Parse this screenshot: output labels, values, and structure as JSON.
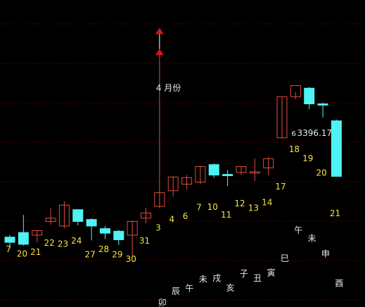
{
  "colors": {
    "background": "#000000",
    "up": "#e24b3a",
    "down": "#4ff3f3",
    "grid": "#5a0000",
    "count_label": "#f5e33a",
    "branch_label": "#e8e8e8",
    "marker": "#e01010",
    "vline": "#ffffff"
  },
  "annotations": {
    "month_label": "4 月份",
    "price_label": "3396.17",
    "price_marker": "6"
  },
  "chart_data": {
    "type": "candlestick",
    "ylim": [
      2970,
      3440
    ],
    "grid": true,
    "candles": [
      {
        "o": 3077,
        "h": 3080,
        "l": 3060,
        "c": 3069
      },
      {
        "o": 3084,
        "h": 3111,
        "l": 3064,
        "c": 3066
      },
      {
        "o": 3080,
        "h": 3087,
        "l": 3069,
        "c": 3087
      },
      {
        "o": 3101,
        "h": 3121,
        "l": 3096,
        "c": 3106
      },
      {
        "o": 3094,
        "h": 3132,
        "l": 3090,
        "c": 3126
      },
      {
        "o": 3119,
        "h": 3120,
        "l": 3095,
        "c": 3101
      },
      {
        "o": 3104,
        "h": 3106,
        "l": 3072,
        "c": 3094
      },
      {
        "o": 3090,
        "h": 3094,
        "l": 3074,
        "c": 3083
      },
      {
        "o": 3086,
        "h": 3088,
        "l": 3065,
        "c": 3073
      },
      {
        "o": 3080,
        "h": 3102,
        "l": 3047,
        "c": 3101
      },
      {
        "o": 3106,
        "h": 3122,
        "l": 3098,
        "c": 3114
      },
      {
        "o": 3124,
        "h": 3360,
        "l": 3121,
        "c": 3145
      },
      {
        "o": 3148,
        "h": 3170,
        "l": 3139,
        "c": 3169
      },
      {
        "o": 3158,
        "h": 3172,
        "l": 3150,
        "c": 3168
      },
      {
        "o": 3161,
        "h": 3185,
        "l": 3158,
        "c": 3185
      },
      {
        "o": 3188,
        "h": 3190,
        "l": 3168,
        "c": 3172
      },
      {
        "o": 3173,
        "h": 3180,
        "l": 3155,
        "c": 3171
      },
      {
        "o": 3176,
        "h": 3185,
        "l": 3172,
        "c": 3185
      },
      {
        "o": 3175,
        "h": 3197,
        "l": 3163,
        "c": 3177
      },
      {
        "o": 3183,
        "h": 3200,
        "l": 3172,
        "c": 3197
      },
      {
        "o": 3229,
        "h": 3292,
        "l": 3229,
        "c": 3292
      },
      {
        "o": 3292,
        "h": 3299,
        "l": 3288,
        "c": 3309
      },
      {
        "o": 3305,
        "h": 3307,
        "l": 3273,
        "c": 3281
      },
      {
        "o": 3281,
        "h": 3283,
        "l": 3260,
        "c": 3279
      },
      {
        "o": 3255,
        "h": 3257,
        "l": 3170,
        "c": 3170
      }
    ],
    "up_marker_values": [
      3392,
      3360
    ],
    "vline_candle_index": 11,
    "counts": [
      {
        "text": "7",
        "candle": -0.1,
        "value": 3054
      },
      {
        "text": "20",
        "candle": 0.9,
        "value": 3047
      },
      {
        "text": "21",
        "candle": 1.9,
        "value": 3050
      },
      {
        "text": "22",
        "candle": 2.9,
        "value": 3064
      },
      {
        "text": "23",
        "candle": 3.9,
        "value": 3062
      },
      {
        "text": "24",
        "candle": 4.9,
        "value": 3067
      },
      {
        "text": "27",
        "candle": 5.9,
        "value": 3046
      },
      {
        "text": "28",
        "candle": 6.9,
        "value": 3054
      },
      {
        "text": "29",
        "candle": 7.9,
        "value": 3046
      },
      {
        "text": "30",
        "candle": 8.9,
        "value": 3039
      },
      {
        "text": "31",
        "candle": 9.9,
        "value": 3067
      },
      {
        "text": "3",
        "candle": 10.9,
        "value": 3087
      },
      {
        "text": "4",
        "candle": 11.9,
        "value": 3100
      },
      {
        "text": "6",
        "candle": 12.9,
        "value": 3105
      },
      {
        "text": "7",
        "candle": 13.9,
        "value": 3118
      },
      {
        "text": "10",
        "candle": 14.9,
        "value": 3119
      },
      {
        "text": "11",
        "candle": 15.9,
        "value": 3107
      },
      {
        "text": "12",
        "candle": 16.9,
        "value": 3124
      },
      {
        "text": "13",
        "candle": 17.9,
        "value": 3117
      },
      {
        "text": "14",
        "candle": 18.9,
        "value": 3126
      },
      {
        "text": "17",
        "candle": 19.9,
        "value": 3150
      },
      {
        "text": "18",
        "candle": 20.9,
        "value": 3207
      },
      {
        "text": "19",
        "candle": 21.9,
        "value": 3193
      },
      {
        "text": "20",
        "candle": 22.9,
        "value": 3171
      },
      {
        "text": "21",
        "candle": 23.9,
        "value": 3109
      }
    ],
    "branches": [
      {
        "text": "卯",
        "candle": 11.2,
        "value": 2972
      },
      {
        "text": "辰",
        "candle": 12.2,
        "value": 2990
      },
      {
        "text": "午",
        "candle": 13.2,
        "value": 2994
      },
      {
        "text": "未",
        "candle": 14.2,
        "value": 3008
      },
      {
        "text": "戌",
        "candle": 15.2,
        "value": 3010
      },
      {
        "text": "亥",
        "candle": 16.2,
        "value": 2995
      },
      {
        "text": "子",
        "candle": 17.2,
        "value": 3017
      },
      {
        "text": "丑",
        "candle": 18.2,
        "value": 3010
      },
      {
        "text": "寅",
        "candle": 19.2,
        "value": 3018
      },
      {
        "text": "巳",
        "candle": 20.2,
        "value": 3040
      },
      {
        "text": "午",
        "candle": 21.2,
        "value": 3083
      },
      {
        "text": "未",
        "candle": 22.2,
        "value": 3071
      },
      {
        "text": "申",
        "candle": 23.2,
        "value": 3047
      },
      {
        "text": "酉",
        "candle": 24.2,
        "value": 3002
      }
    ],
    "month_label_pos": {
      "candle": 10.9,
      "value": 3301
    },
    "price_label_pos": {
      "candle": 20.7,
      "value": 3232
    }
  }
}
